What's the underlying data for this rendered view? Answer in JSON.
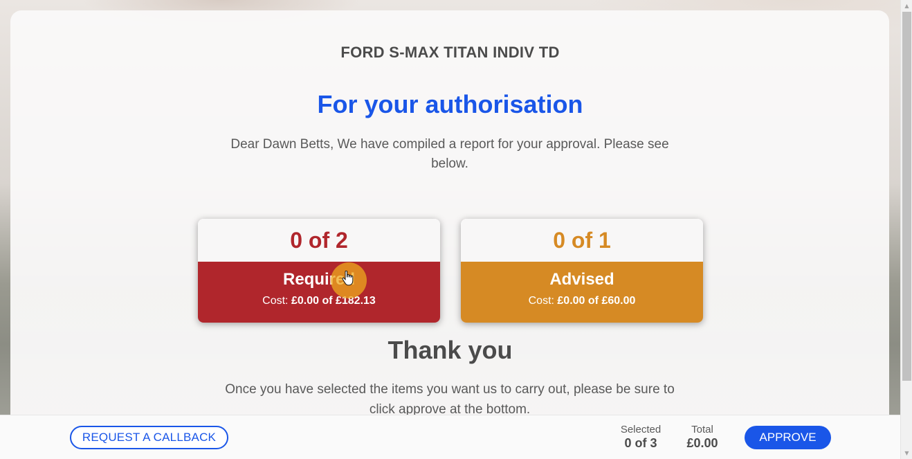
{
  "vehicle": {
    "name": "FORD S-MAX TITAN INDIV TD"
  },
  "page": {
    "heading": "For your authorisation",
    "intro": "Dear Dawn Betts, We have compiled a report for your approval. Please see below."
  },
  "tiles": {
    "required": {
      "count": "0 of 2",
      "label": "Required",
      "cost_prefix": "Cost:",
      "cost_value": "£0.00 of £182.13",
      "color": "#b0262c"
    },
    "advised": {
      "count": "0 of 1",
      "label": "Advised",
      "cost_prefix": "Cost:",
      "cost_value": "£0.00 of £60.00",
      "color": "#d68a24"
    }
  },
  "thanks": {
    "heading": "Thank you",
    "text": "Once you have selected the items you want us to carry out, please be sure to click approve at the bottom."
  },
  "footer": {
    "callback_label": "REQUEST A CALLBACK",
    "selected_label": "Selected",
    "selected_value": "0 of 3",
    "total_label": "Total",
    "total_value": "£0.00",
    "approve_label": "APPROVE"
  },
  "colors": {
    "accent": "#1a56e8",
    "required": "#b0262c",
    "advised": "#d68a24"
  },
  "icons": {
    "cursor": "hand-pointer-icon",
    "scroll_up": "scroll-up-arrow-icon",
    "scroll_down": "scroll-down-arrow-icon"
  }
}
